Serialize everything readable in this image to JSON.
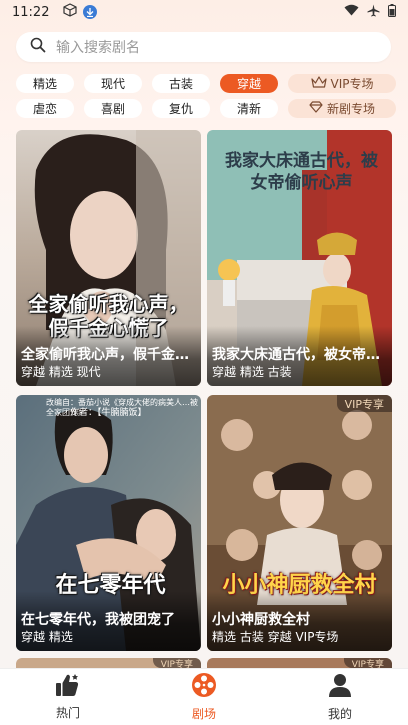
{
  "status": {
    "time": "11:22"
  },
  "search": {
    "placeholder": "输入搜索剧名"
  },
  "filters": {
    "row1": [
      "精选",
      "现代",
      "古装",
      "穿越"
    ],
    "row1_special": "VIP专场",
    "row2": [
      "虐恋",
      "喜剧",
      "复仇",
      "清新"
    ],
    "row2_special": "新剧专场",
    "active": "穿越"
  },
  "cards": [
    {
      "title": "全家偷听我心声，假千金心慌了",
      "tags": "穿越 精选 现代",
      "poster_text": "全家偷听我心声，假千金心慌了",
      "vip": ""
    },
    {
      "title": "我家大床通古代，被女帝偷听心声",
      "tags": "穿越 精选 古装",
      "poster_text": "我家大床通古代，被女帝偷听心声",
      "vip": ""
    },
    {
      "title": "在七零年代，我被团宠了",
      "tags": "穿越 精选",
      "poster_text": "在七零年代",
      "credit_line1": "改编自：番茄小说《穿成大佬的病美人…被全家团宠》",
      "credit_line2": "作者：【牛腩腩饭】",
      "vip": ""
    },
    {
      "title": "小小神厨救全村",
      "tags": "精选 古装 穿越 VIP专场",
      "poster_text": "小小神厨救全村",
      "vip": "VIP专享"
    }
  ],
  "peek": [
    "VIP专享",
    "VIP专享"
  ],
  "tabbar": [
    {
      "label": "热门",
      "icon": "thumbs-up-icon"
    },
    {
      "label": "剧场",
      "icon": "film-reel-icon"
    },
    {
      "label": "我的",
      "icon": "person-icon"
    }
  ],
  "colors": {
    "accent": "#ec5a23",
    "chip_special_bg": "#fbe3d6"
  }
}
